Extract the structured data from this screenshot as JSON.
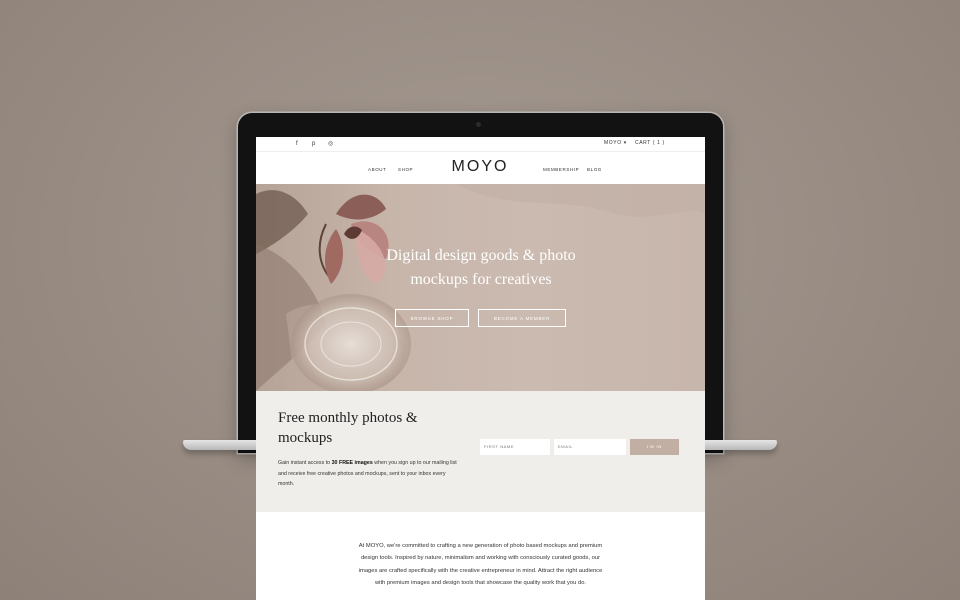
{
  "topbar": {
    "social_icons": [
      "facebook-icon",
      "pinterest-icon",
      "instagram-icon"
    ],
    "social_glyphs": [
      "f",
      "p",
      "◎"
    ],
    "account_label": "MOYO",
    "account_caret": "▾",
    "cart_label": "CART ( 1 )"
  },
  "nav": {
    "left_links": [
      "ABOUT",
      "SHOP"
    ],
    "logo": "MOYO",
    "right_links": [
      "MEMBERSHIP",
      "BLOG"
    ]
  },
  "hero": {
    "title": "Digital design goods & photo mockups for creatives",
    "buttons": [
      "BROWSE SHOP",
      "BECOME A MEMBER"
    ]
  },
  "signup": {
    "title": "Free monthly photos & mockups",
    "text_before": "Gain instant access to ",
    "text_bold": "30 FREE images",
    "text_after": " when you sign up to our mailing list and receive free creative photos and mockups, sent to your inbox every month.",
    "first_name_placeholder": "FIRST NAME",
    "email_placeholder": "EMAIL",
    "submit_label": "I'M IN"
  },
  "about": {
    "text": "At MOYO, we're committed to crafting a new generation of photo based mockups and premium design tools. Inspired by nature, minimalism and working with consciously curated goods, our images are crafted specifically with the creative entrepreneur in mind. Attract the right audience with premium images and design tools that showcase the quality work that you do."
  },
  "colors": {
    "background": "#988c83",
    "hero": "#c7b5aa",
    "signup_bg": "#f0eeeb",
    "accent_button": "#c2afa4"
  }
}
